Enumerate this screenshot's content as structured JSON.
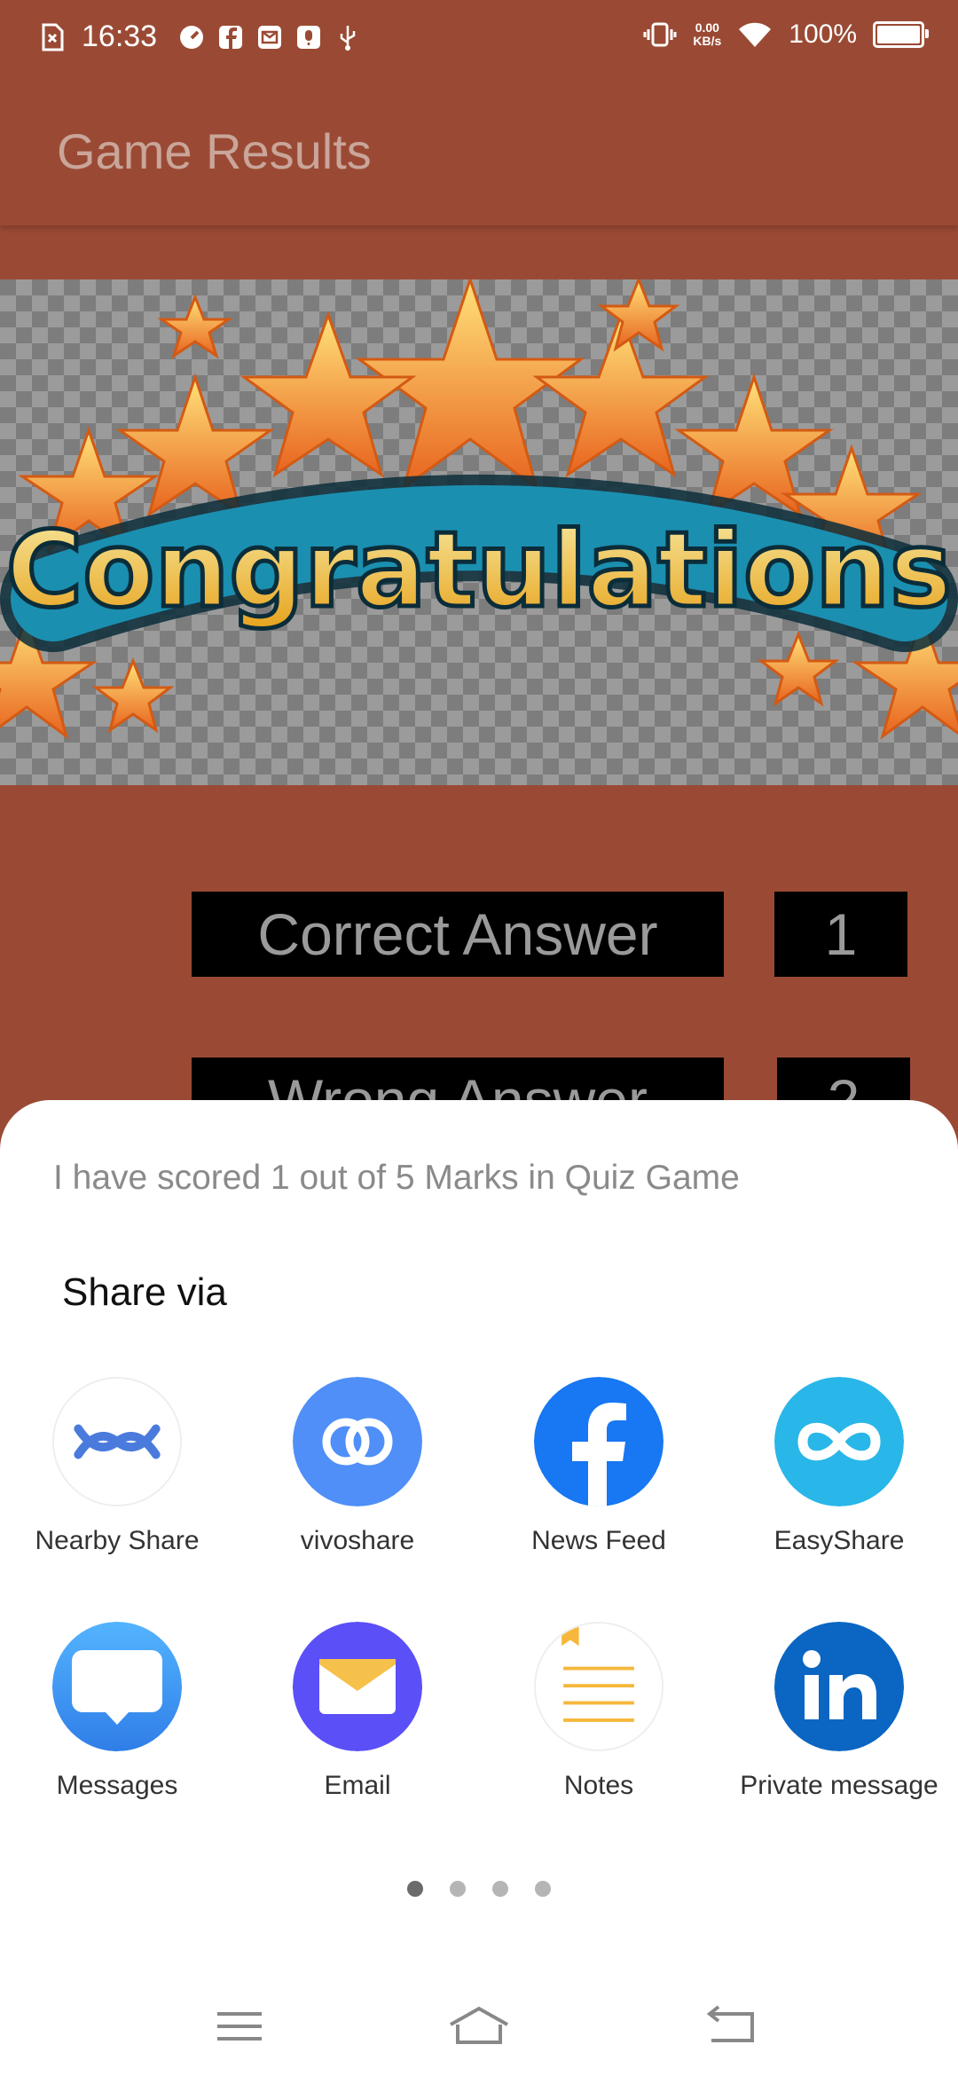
{
  "status_bar": {
    "time": "16:33",
    "speed_value": "0.00",
    "speed_unit": "KB/s",
    "battery": "100%"
  },
  "app_bar": {
    "title": "Game Results"
  },
  "banner": {
    "text": "Congratulations"
  },
  "scores": {
    "correct_label": "Correct Answer",
    "correct_value": "1",
    "wrong_label": "Wrong Answer",
    "wrong_value": "2"
  },
  "share_sheet": {
    "message": "I have scored 1 out of 5 Marks in Quiz Game",
    "title": "Share via",
    "apps": [
      {
        "label": "Nearby Share",
        "icon": "nearby-share-icon"
      },
      {
        "label": "vivoshare",
        "icon": "vivoshare-icon"
      },
      {
        "label": "News Feed",
        "icon": "facebook-icon"
      },
      {
        "label": "EasyShare",
        "icon": "easyshare-icon"
      },
      {
        "label": "Messages",
        "icon": "messages-icon"
      },
      {
        "label": "Email",
        "icon": "email-icon"
      },
      {
        "label": "Notes",
        "icon": "notes-icon"
      },
      {
        "label": "Private message",
        "icon": "linkedin-icon"
      }
    ],
    "page_count": 4,
    "current_page": 1
  },
  "colors": {
    "primary": "#9a4a34",
    "facebook": "#1877f2",
    "linkedin": "#0a66c2",
    "vivoshare": "#4f8ff7",
    "easyshare": "#29b6e8",
    "email": "#5b4ff7"
  },
  "nav_bar": {
    "icons": [
      "menu-icon",
      "home-icon",
      "back-icon"
    ]
  }
}
